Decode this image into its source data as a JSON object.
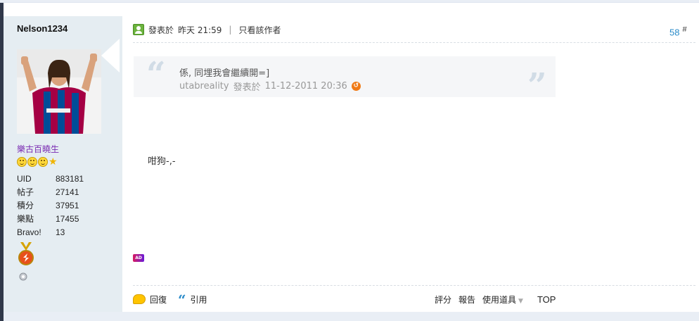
{
  "author": {
    "username": "Nelson1234",
    "usergroup": "樂古百曉生",
    "rating_icons": [
      "smiley-icon",
      "smiley-icon",
      "smiley-icon",
      "star-icon"
    ],
    "stats": [
      {
        "label": "UID",
        "value": "883181"
      },
      {
        "label": "帖子",
        "value": "27141"
      },
      {
        "label": "積分",
        "value": "37951"
      },
      {
        "label": "樂點",
        "value": "17455"
      },
      {
        "label": "Bravo!",
        "value": "13"
      }
    ]
  },
  "post": {
    "posted_label": "發表於",
    "posted_time": "昨天 21:59",
    "separator": "|",
    "only_author_label": "只看該作者",
    "floor_number": "58",
    "floor_symbol": "#",
    "quote": {
      "text": "係, 同埋我會繼續開=]",
      "author": "utabreality",
      "posted_label": "發表於",
      "time": "11-12-2011 20:36"
    },
    "message": "咁狗-,-",
    "ad_label": "AD"
  },
  "actions": {
    "reply": "回復",
    "quote": "引用",
    "rate": "評分",
    "report": "報告",
    "tools": "使用道具",
    "top": "TOP"
  },
  "colors": {
    "sidebar_bg": "#e5edf2",
    "link_blue": "#2a8bc9",
    "usergroup_purple": "#7a2bb2",
    "quote_bg": "#f5f6f8"
  }
}
